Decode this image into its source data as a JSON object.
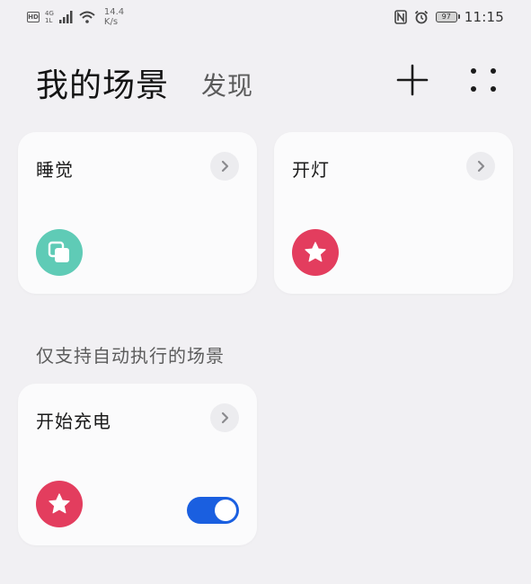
{
  "status_bar": {
    "hd": "HD",
    "net_type": "4G",
    "net_sub": "1L",
    "speed_value": "14.4",
    "speed_unit": "K/s",
    "battery": "97",
    "time": "11:15"
  },
  "header": {
    "title": "我的场景",
    "discover_tab": "发现",
    "add_icon": "plus-icon",
    "more_icon": "four-dots-icon"
  },
  "colors": {
    "background": "#f1f0f3",
    "card": "#fbfbfc",
    "teal": "#5fcbb6",
    "pink": "#e33d5e",
    "toggle_on": "#1a5fe0"
  },
  "scenes": [
    {
      "title": "睡觉",
      "icon": "copy-squares-icon",
      "icon_color": "#5fcbb6"
    },
    {
      "title": "开灯",
      "icon": "star-icon",
      "icon_color": "#e33d5e"
    }
  ],
  "auto_section": {
    "label": "仅支持自动执行的场景",
    "scenes": [
      {
        "title": "开始充电",
        "icon": "star-icon",
        "icon_color": "#e33d5e",
        "enabled": true
      }
    ]
  }
}
